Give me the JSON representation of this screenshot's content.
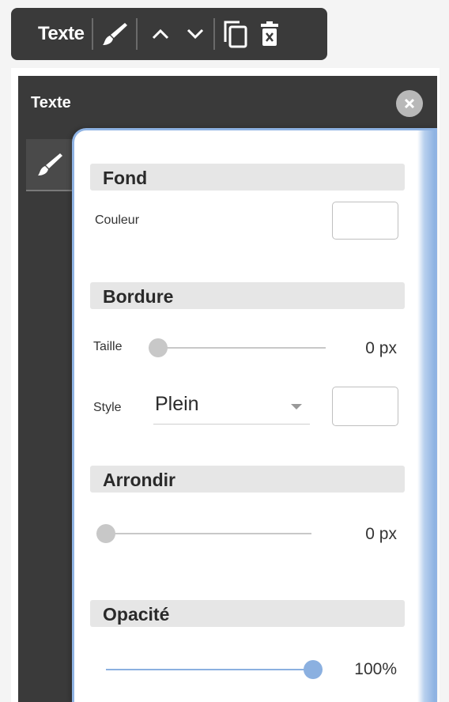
{
  "toolbar": {
    "label": "Texte",
    "icons": [
      "brush-icon",
      "chevron-up-icon",
      "chevron-down-icon",
      "copy-icon",
      "delete-icon"
    ]
  },
  "panel": {
    "title": "Texte",
    "tabs": [
      "brush-icon"
    ]
  },
  "fond": {
    "header": "Fond",
    "color_label": "Couleur",
    "color": "#ffffff"
  },
  "bordure": {
    "header": "Bordure",
    "size_label": "Taille",
    "size_value": "0 px",
    "size_level": 0,
    "style_label": "Style",
    "style_value": "Plein",
    "color": "#ffffff"
  },
  "arrondir": {
    "header": "Arrondir",
    "value": "0 px",
    "level": 0
  },
  "opacite": {
    "header": "Opacité",
    "value": "100%",
    "level": 100
  },
  "colors": {
    "dark": "#3a3a3a",
    "accent": "#8bb0e0",
    "section_bg": "#e6e6e6"
  }
}
